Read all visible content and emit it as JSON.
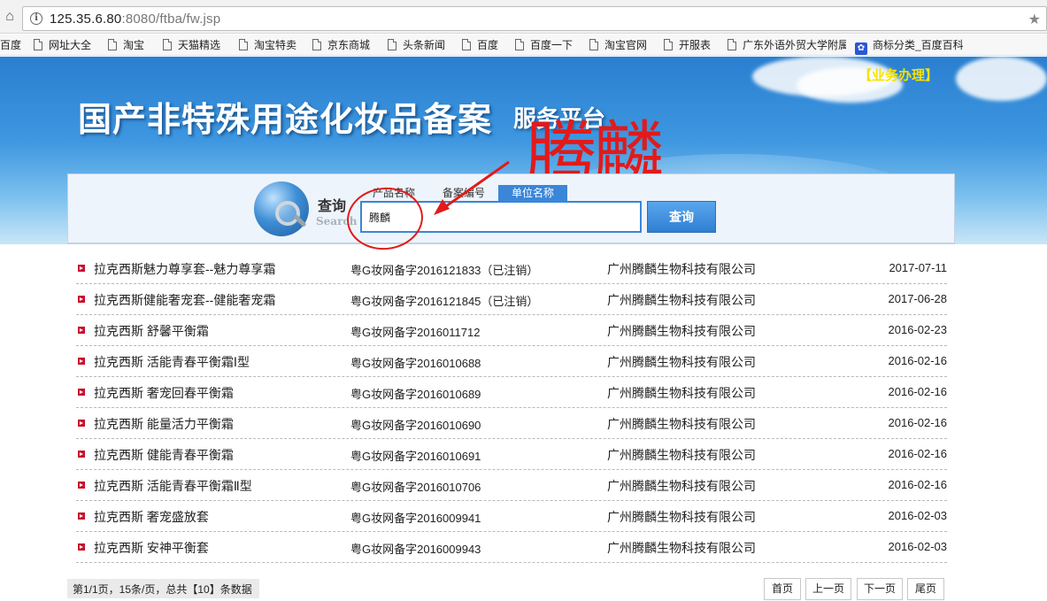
{
  "browser": {
    "url_host": "125.35.6.80",
    "url_rest": ":8080/ftba/fw.jsp",
    "bookmarks": [
      "百度",
      "网址大全",
      "淘宝",
      "天猫精选",
      "淘宝特卖",
      "京东商城",
      "头条新闻",
      "百度",
      "百度一下",
      "淘宝官网",
      "开服表",
      "广东外语外贸大学附属",
      "商标分类_百度百科"
    ]
  },
  "banner": {
    "title": "国产非特殊用途化妆品备案",
    "subtitle": "服务平台",
    "business_link": "【业务办理】"
  },
  "search": {
    "label": "查询",
    "label_en": "Search",
    "tabs": [
      {
        "label": "产品名称",
        "active": false
      },
      {
        "label": "备案编号",
        "active": false
      },
      {
        "label": "单位名称",
        "active": true
      }
    ],
    "input_value": "腾麟",
    "button_label": "查询"
  },
  "annotation": {
    "text": "腾麟",
    "color": "#e21a1a"
  },
  "results": [
    {
      "name": "拉克西斯魅力尊享套--魅力尊享霜",
      "code": "粤G妆网备字2016121833（已注销）",
      "company": "广州腾麟生物科技有限公司",
      "date": "2017-07-11"
    },
    {
      "name": "拉克西斯健能奢宠套--健能奢宠霜",
      "code": "粤G妆网备字2016121845（已注销）",
      "company": "广州腾麟生物科技有限公司",
      "date": "2017-06-28"
    },
    {
      "name": "拉克西斯 舒馨平衡霜",
      "code": "粤G妆网备字2016011712",
      "company": "广州腾麟生物科技有限公司",
      "date": "2016-02-23"
    },
    {
      "name": "拉克西斯 活能青春平衡霜Ⅰ型",
      "code": "粤G妆网备字2016010688",
      "company": "广州腾麟生物科技有限公司",
      "date": "2016-02-16"
    },
    {
      "name": "拉克西斯 奢宠回春平衡霜",
      "code": "粤G妆网备字2016010689",
      "company": "广州腾麟生物科技有限公司",
      "date": "2016-02-16"
    },
    {
      "name": "拉克西斯 能量活力平衡霜",
      "code": "粤G妆网备字2016010690",
      "company": "广州腾麟生物科技有限公司",
      "date": "2016-02-16"
    },
    {
      "name": "拉克西斯 健能青春平衡霜",
      "code": "粤G妆网备字2016010691",
      "company": "广州腾麟生物科技有限公司",
      "date": "2016-02-16"
    },
    {
      "name": "拉克西斯 活能青春平衡霜Ⅱ型",
      "code": "粤G妆网备字2016010706",
      "company": "广州腾麟生物科技有限公司",
      "date": "2016-02-16"
    },
    {
      "name": "拉克西斯 奢宠盛放套",
      "code": "粤G妆网备字2016009941",
      "company": "广州腾麟生物科技有限公司",
      "date": "2016-02-03"
    },
    {
      "name": "拉克西斯 安神平衡套",
      "code": "粤G妆网备字2016009943",
      "company": "广州腾麟生物科技有限公司",
      "date": "2016-02-03"
    }
  ],
  "pagination": {
    "info": "第1/1页，15条/页，总共【10】条数据",
    "first": "首页",
    "prev": "上一页",
    "next": "下一页",
    "last": "尾页"
  }
}
